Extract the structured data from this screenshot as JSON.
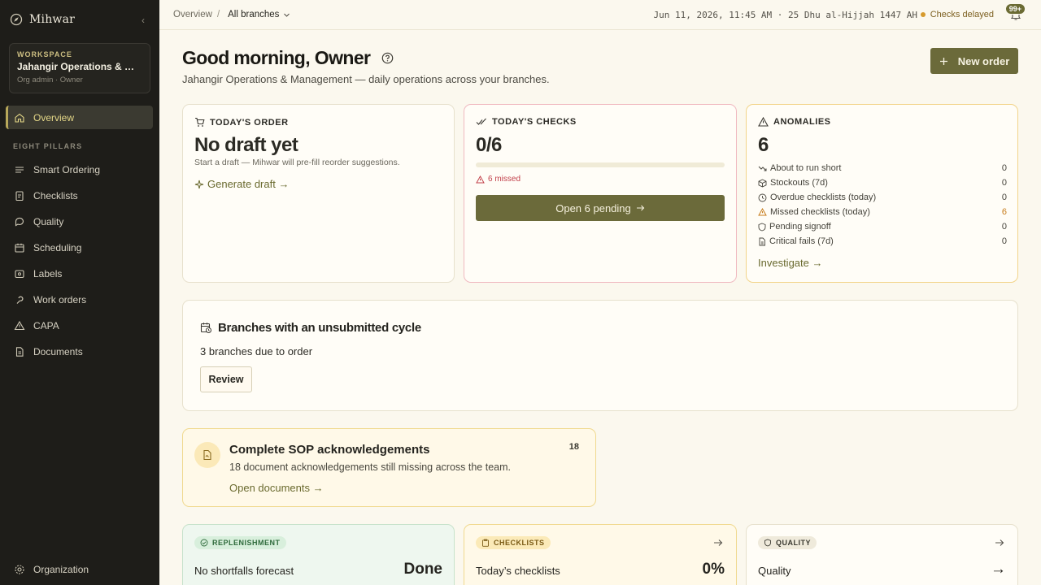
{
  "sidebar": {
    "brand": "Mihwar",
    "workspace_kicker": "WORKSPACE",
    "workspace_name": "Jahangir Operations & Management",
    "workspace_role": "Org admin · Owner",
    "overview_label": "Overview",
    "section_label": "EIGHT PILLARS",
    "items": [
      {
        "label": "Smart Ordering",
        "icon": "list-icon"
      },
      {
        "label": "Checklists",
        "icon": "checklist-icon"
      },
      {
        "label": "Quality",
        "icon": "chat-icon"
      },
      {
        "label": "Scheduling",
        "icon": "calendar-icon"
      },
      {
        "label": "Labels",
        "icon": "label-icon"
      },
      {
        "label": "Work orders",
        "icon": "wrench-icon"
      },
      {
        "label": "CAPA",
        "icon": "warning-icon"
      },
      {
        "label": "Documents",
        "icon": "document-icon"
      }
    ],
    "footer_label": "Organization"
  },
  "topbar": {
    "crumb_root": "Overview",
    "crumb_sep": "/",
    "branch_select": "All branches",
    "datetime": "Jun 11, 2026, 11:45 AM · 25 Dhu al-Hijjah 1447 AH",
    "status": "Checks delayed",
    "notif_count": "99+"
  },
  "header": {
    "greeting": "Good morning, Owner",
    "subtitle": "Jahangir Operations & Management — daily operations across your branches.",
    "new_order": "New order"
  },
  "todays_order": {
    "title": "TODAY'S ORDER",
    "headline": "No draft yet",
    "desc": "Start a draft — Mihwar will pre-fill reorder suggestions.",
    "link": "Generate draft →"
  },
  "todays_checks": {
    "title": "TODAY'S CHECKS",
    "value": "0/6",
    "progress": 0,
    "missed": "6 missed",
    "button": "Open 6 pending"
  },
  "anomalies": {
    "title": "ANOMALIES",
    "value": "6",
    "rows": [
      {
        "label": "About to run short",
        "value": "0",
        "icon": "trend-down-icon"
      },
      {
        "label": "Stockouts (7d)",
        "value": "0",
        "icon": "package-icon"
      },
      {
        "label": "Overdue checklists (today)",
        "value": "0",
        "icon": "clock-icon"
      },
      {
        "label": "Missed checklists (today)",
        "value": "6",
        "icon": "warning-icon"
      },
      {
        "label": "Pending signoff",
        "value": "0",
        "icon": "shield-icon"
      },
      {
        "label": "Critical fails (7d)",
        "value": "0",
        "icon": "file-icon"
      }
    ],
    "link": "Investigate →"
  },
  "branches": {
    "title": "Branches with an unsubmitted cycle",
    "desc": "3 branches due to order",
    "button": "Review"
  },
  "sop": {
    "title": "Complete SOP acknowledgements",
    "desc": "18 document acknowledgements still missing across the team.",
    "link": "Open documents →",
    "count": "18"
  },
  "bottom_cards": [
    {
      "pill": "REPLENISHMENT",
      "title": "No shortfalls forecast",
      "value": "Done"
    },
    {
      "pill": "CHECKLISTS",
      "title": "Today’s checklists",
      "value": "0%"
    },
    {
      "pill": "QUALITY",
      "title": "Quality",
      "value": "→"
    }
  ],
  "colors": {
    "accent": "#6b6a3a",
    "sidebar_bg": "#1e1d19",
    "warning": "#c77c1b",
    "danger": "#c2414b"
  }
}
